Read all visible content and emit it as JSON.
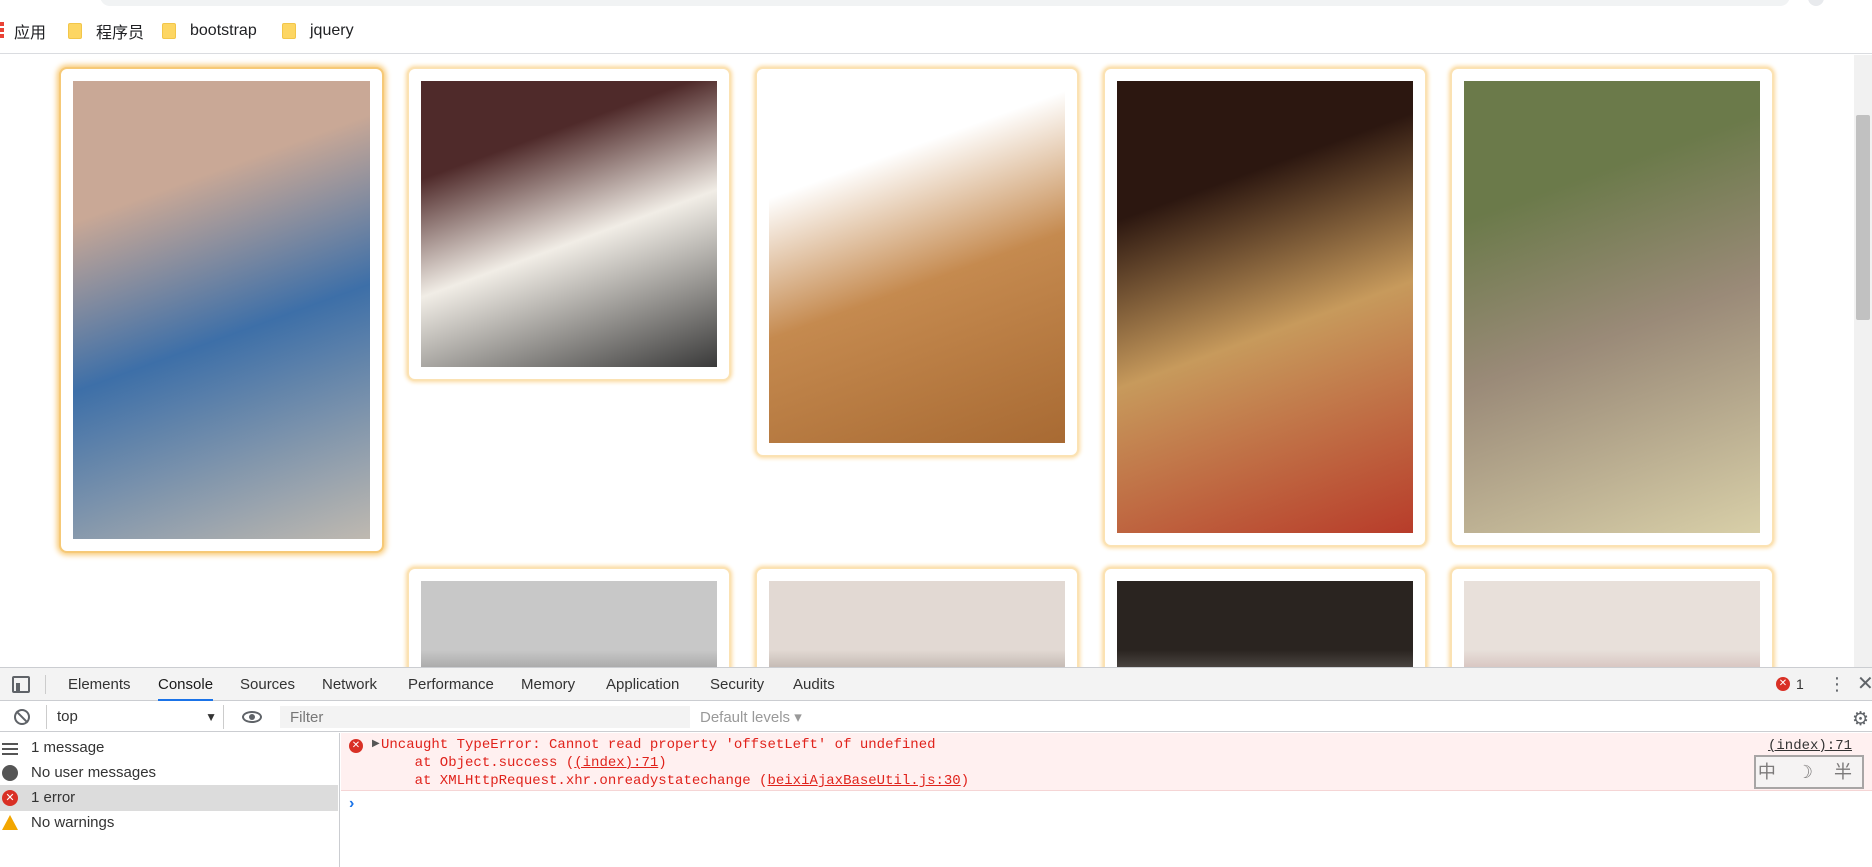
{
  "bookmarks": {
    "items": [
      {
        "label": "应用",
        "icon": "apps-icon"
      },
      {
        "label": "程序员",
        "icon": "folder-icon"
      },
      {
        "label": "bootstrap",
        "icon": "folder-icon"
      },
      {
        "label": "jquery",
        "icon": "folder-icon"
      }
    ]
  },
  "waterfall": {
    "images": [
      {
        "subject": "fringed cardigan with jeans",
        "colors": [
          "#c9a896",
          "#3d6fa8",
          "#bfb9b0"
        ]
      },
      {
        "subject": "black rose drop earrings on white cylinder",
        "colors": [
          "#4f2a2a",
          "#f1ede6",
          "#3a3a3a"
        ]
      },
      {
        "subject": "tan fringed over-knee boot",
        "colors": [
          "#ffffff",
          "#c58a4f",
          "#a86a33"
        ]
      },
      {
        "subject": "gold fringe dress with red handbag",
        "colors": [
          "#2c1710",
          "#c79a5c",
          "#b83c2a"
        ]
      },
      {
        "subject": "grey fringe gown on runway",
        "colors": [
          "#6b7a4a",
          "#9a8a78",
          "#d8cfa8"
        ]
      },
      {
        "subject": "model with ponytail",
        "colors": [
          "#c8c8c8",
          "#1e1e1e"
        ]
      },
      {
        "subject": "model face slicked hair",
        "colors": [
          "#e2d9d3",
          "#3a2a22"
        ]
      },
      {
        "subject": "white leather fringe",
        "colors": [
          "#2a2420",
          "#e0ddd8"
        ]
      },
      {
        "subject": "close up face red lips",
        "colors": [
          "#e8e0da",
          "#8c4a4e"
        ]
      }
    ]
  },
  "devtools": {
    "tabs": [
      "Elements",
      "Console",
      "Sources",
      "Network",
      "Performance",
      "Memory",
      "Application",
      "Security",
      "Audits"
    ],
    "active_tab": "Console",
    "error_count": "1",
    "context": "top",
    "filter_placeholder": "Filter",
    "levels": "Default levels ▾",
    "sidebar": [
      {
        "label": "1 message",
        "icon": "list-icon"
      },
      {
        "label": "No user messages",
        "icon": "user-icon"
      },
      {
        "label": "1 error",
        "icon": "error-icon"
      },
      {
        "label": "No warnings",
        "icon": "warning-icon"
      }
    ],
    "console": {
      "error_line": "Uncaught TypeError: Cannot read property 'offsetLeft' of undefined",
      "stack1_prefix": "    at Object.success (",
      "stack1_link": "(index):71",
      "stack1_suffix": ")",
      "stack2_prefix": "    at XMLHttpRequest.xhr.onreadystatechange (",
      "stack2_link": "beixiAjaxBaseUtil.js:30",
      "stack2_suffix": ")",
      "source": "(index):71",
      "prompt": "›"
    },
    "ime_indicator": "中 ☽ 半"
  }
}
